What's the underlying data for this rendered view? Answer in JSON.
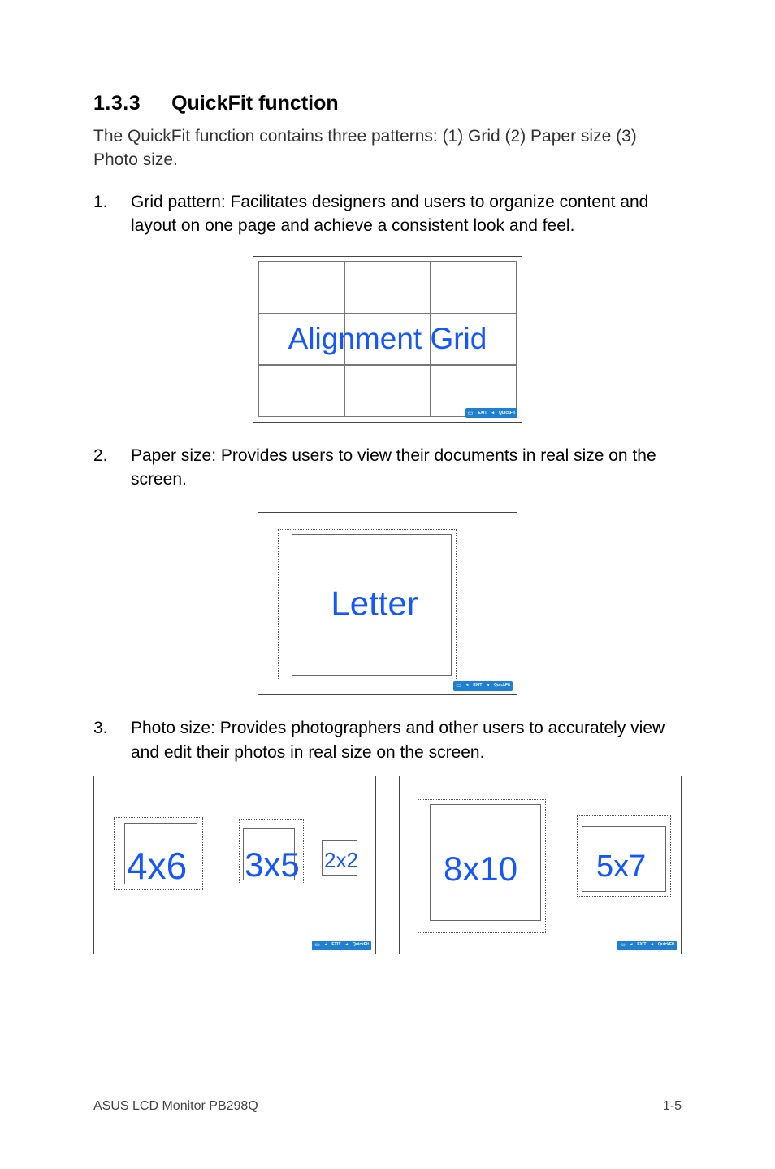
{
  "heading": {
    "number": "1.3.3",
    "title": "QuickFit function"
  },
  "intro": "The QuickFit function contains three patterns: (1) Grid (2) Paper size (3) Photo size.",
  "items": [
    {
      "num": "1.",
      "text": "Grid pattern: Facilitates designers and users to organize content and layout on one page and achieve a consistent look and feel."
    },
    {
      "num": "2.",
      "text": "Paper size: Provides users to view their documents in real size on the screen."
    },
    {
      "num": "3.",
      "text": "Photo size: Provides photographers and other users to accurately view and edit their photos in real size on the screen."
    }
  ],
  "figures": {
    "grid_label": "Alignment Grid",
    "paper_label": "Letter",
    "photo1": {
      "a": "4x6",
      "b": "3x5",
      "c": "2x2"
    },
    "photo2": {
      "a": "8x10",
      "b": "5x7"
    },
    "badge": {
      "exit": "EXIT",
      "quickfit": "QuickFit",
      "triangle": "◂"
    }
  },
  "footer": {
    "left": "ASUS LCD Monitor PB298Q",
    "right": "1-5"
  }
}
